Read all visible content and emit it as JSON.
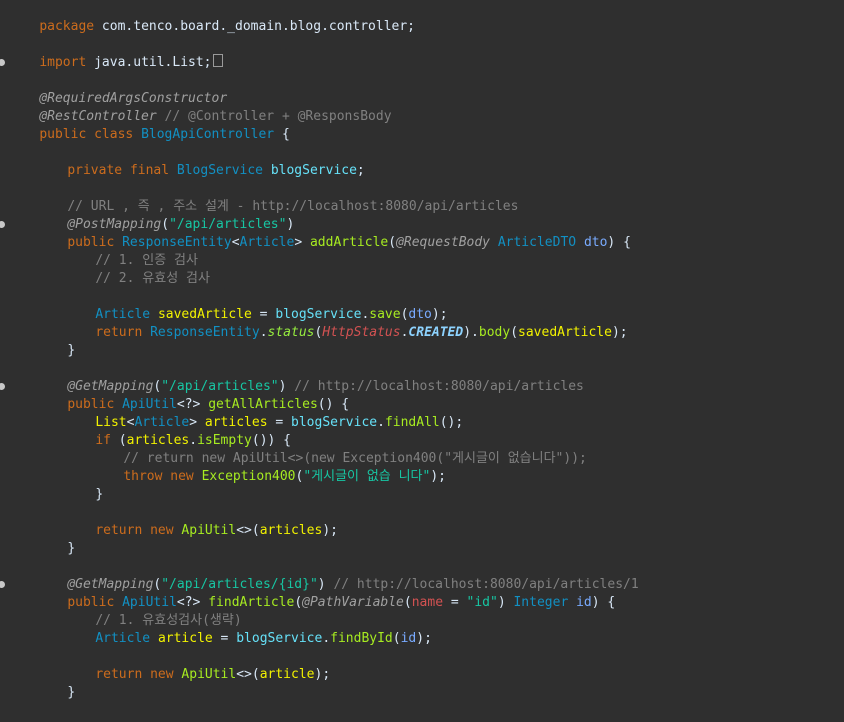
{
  "editor": {
    "lines": {
      "l01": [
        "package",
        " com.tenco.board._domain.blog.controller;"
      ],
      "l03": [
        "import",
        " java.util.List;"
      ],
      "l05": "@RequiredArgsConstructor",
      "l06": [
        "@RestController",
        " // @Controller + @ResponsBody"
      ],
      "l07": [
        "public",
        " ",
        "class",
        " ",
        "BlogApiController",
        " {"
      ],
      "l09": [
        "private",
        " ",
        "final",
        " ",
        "BlogService",
        " ",
        "blogService",
        ";"
      ],
      "l11": "// URL , 즉 , 주소 설계 - http://localhost:8080/api/articles",
      "l12": [
        "@PostMapping",
        "(",
        "\"/api/articles\"",
        ")"
      ],
      "l13": [
        "public",
        " ",
        "ResponseEntity",
        "<",
        "Article",
        "> ",
        "addArticle",
        "(",
        "@RequestBody",
        " ",
        "ArticleDTO",
        " ",
        "dto",
        ") {"
      ],
      "l14": "// 1. 인증 검사",
      "l15": "// 2. 유효성 검사",
      "l17": [
        "Article",
        " ",
        "savedArticle",
        " = ",
        "blogService",
        ".",
        "save",
        "(",
        "dto",
        ");"
      ],
      "l18": [
        "return",
        " ",
        "ResponseEntity",
        ".",
        "status",
        "(",
        "HttpStatus",
        ".",
        "CREATED",
        ")",
        ".",
        "body",
        "(",
        "savedArticle",
        ");"
      ],
      "l19": "}",
      "l21": [
        "@GetMapping",
        "(",
        "\"/api/articles\"",
        ") ",
        "// http://localhost:8080/api/articles"
      ],
      "l22": [
        "public",
        " ",
        "ApiUtil",
        "<?> ",
        "getAllArticles",
        "() {"
      ],
      "l23": [
        "List",
        "<",
        "Article",
        "> ",
        "articles",
        " = ",
        "blogService",
        ".",
        "findAll",
        "();"
      ],
      "l24": [
        "if",
        " (",
        "articles",
        ".",
        "isEmpty",
        "()) {"
      ],
      "l25": "// return new ApiUtil<>(new Exception400(\"게시글이 없습니다\"));",
      "l26": [
        "throw",
        " ",
        "new",
        " ",
        "Exception400",
        "(",
        "\"게시글이 없습 니다\"",
        ");"
      ],
      "l27": "}",
      "l29": [
        "return",
        " ",
        "new",
        " ",
        "ApiUtil",
        "<>(",
        "articles",
        ");"
      ],
      "l30": "}",
      "l32": [
        "@GetMapping",
        "(",
        "\"/api/articles/{id}\"",
        ") ",
        "// http://localhost:8080/api/articles/1"
      ],
      "l33": [
        "public",
        " ",
        "ApiUtil",
        "<?> ",
        "findArticle",
        "(",
        "@PathVariable",
        "(",
        "name",
        " = ",
        "\"id\"",
        ") ",
        "Integer",
        " ",
        "id",
        ") {"
      ],
      "l34": "// 1. 유효성검사(생략)",
      "l35": [
        "Article",
        " ",
        "article",
        " = ",
        "blogService",
        ".",
        "findById",
        "(",
        "id",
        ");"
      ],
      "l37": [
        "return",
        " ",
        "new",
        " ",
        "ApiUtil",
        "<>(",
        "article",
        ");"
      ],
      "l38": "}",
      "l40": "}"
    }
  },
  "colors": {
    "background": "#2f2f2f",
    "keyword": "#cc6c1d",
    "type": "#1290c3",
    "string": "#17c6a3",
    "field": "#66e1f8",
    "method": "#a7ec21",
    "comment": "#808080",
    "annotation": "#a0a0a0",
    "text": "#d9e8f7"
  }
}
